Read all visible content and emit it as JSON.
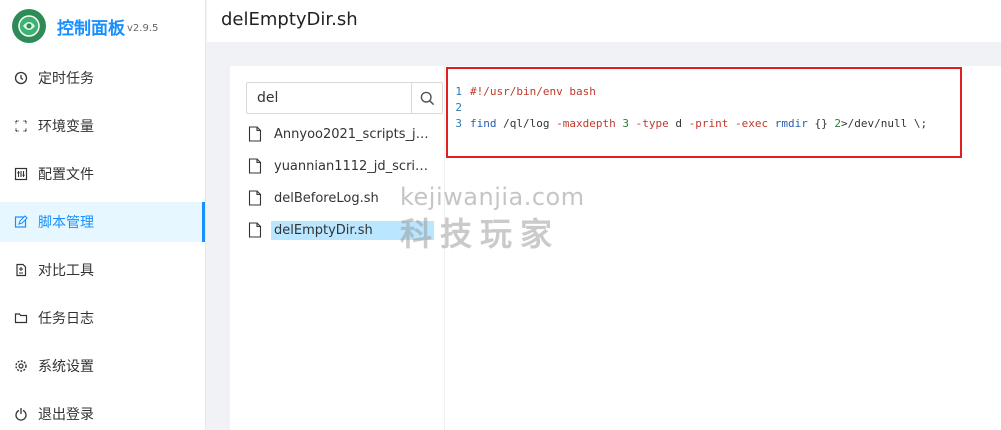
{
  "app": {
    "title": "控制面板",
    "version": "v2.9.5"
  },
  "sidebar": {
    "items": [
      {
        "label": "定时任务",
        "icon": "clock-icon"
      },
      {
        "label": "环境变量",
        "icon": "environment-icon"
      },
      {
        "label": "配置文件",
        "icon": "control-icon"
      },
      {
        "label": "脚本管理",
        "icon": "edit-icon",
        "active": true
      },
      {
        "label": "对比工具",
        "icon": "diff-icon"
      },
      {
        "label": "任务日志",
        "icon": "folder-icon"
      },
      {
        "label": "系统设置",
        "icon": "settings-icon"
      },
      {
        "label": "退出登录",
        "icon": "logout-icon"
      }
    ]
  },
  "header": {
    "title": "delEmptyDir.sh"
  },
  "search": {
    "value": "del"
  },
  "files": [
    "Annyoo2021_scripts_jd_...",
    "yuannian1112_jd_script...",
    "delBeforeLog.sh",
    "delEmptyDir.sh"
  ],
  "selected_file": "delEmptyDir.sh",
  "editor": {
    "lines": [
      {
        "num": "1",
        "text": "#!/usr/bin/env bash"
      },
      {
        "num": "2",
        "text": ""
      },
      {
        "num": "3",
        "text": "find /ql/log -maxdepth 3 -type d -print -exec rmdir {} 2>/dev/null \\;"
      }
    ]
  },
  "watermark": {
    "line1": "kejiwanjia.com",
    "line2": "科技玩家"
  },
  "colors": {
    "accent": "#1890ff",
    "highlight_border": "#e02020"
  }
}
